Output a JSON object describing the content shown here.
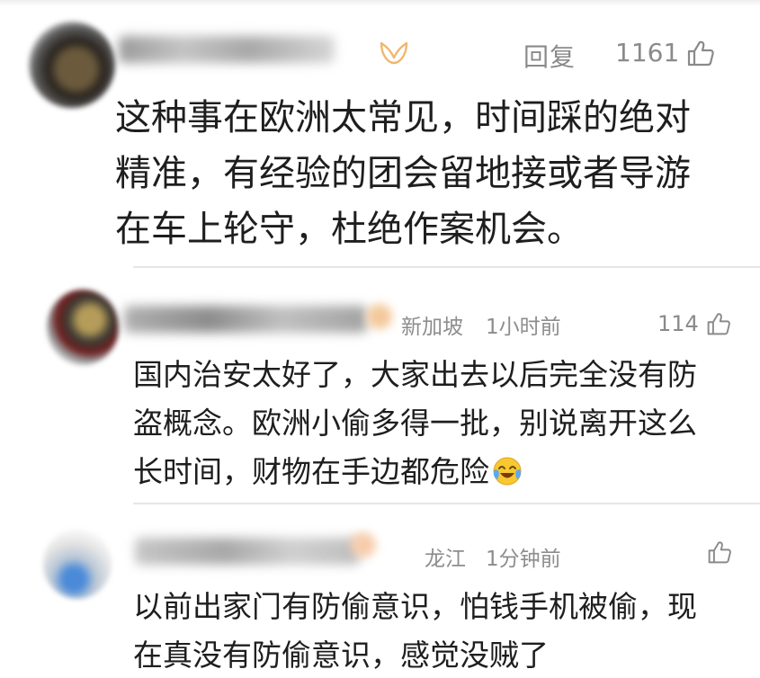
{
  "comments": [
    {
      "reply_label": "回复",
      "like_count": "1161",
      "text_lines": [
        "这种事在欧洲太常见，时间踩的绝对",
        "精准，有经验的团会留地接或者导游",
        "在车上轮守，杜绝作案机会。"
      ]
    },
    {
      "location": "新加坡",
      "time": "1小时前",
      "like_count": "114",
      "text_lines": [
        "国内治安太好了，大家出去以后完全没有防",
        "盗概念。欧洲小偷多得一批，别说离开这么",
        "长时间，财物在手边都危险"
      ]
    },
    {
      "location": "龙江",
      "time": "1分钟前",
      "text_lines": [
        "以前出家门有防偷意识，怕钱手机被偷，现",
        "在真没有防偷意识，感觉没贼了"
      ]
    }
  ],
  "icons": {
    "like": "thumbs-up-outline-icon",
    "vip": "vip-badge-icon",
    "emoji": "crying-laughing-emoji-icon"
  },
  "colors": {
    "meta_text": "#8d8d8d",
    "body_text": "#1e1e1e",
    "divider": "#e6e6e6",
    "vip_badge": "#f0b86e"
  }
}
